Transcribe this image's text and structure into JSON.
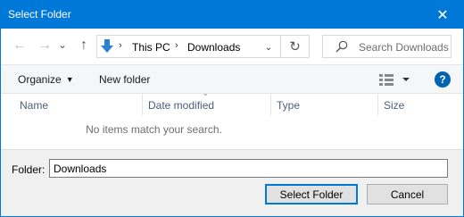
{
  "window": {
    "title": "Select Folder",
    "close_glyph": "✕"
  },
  "nav": {
    "back_glyph": "←",
    "forward_glyph": "→",
    "recent_glyph": "⌄",
    "up_glyph": "↑",
    "breadcrumb": [
      "This PC",
      "Downloads"
    ],
    "breadcrumb_sep": "›",
    "dropdown_glyph": "⌄",
    "refresh_glyph": "↻",
    "search_placeholder": "Search Downloads"
  },
  "commandbar": {
    "organize": "Organize",
    "new_folder": "New folder",
    "help": "?"
  },
  "columns": [
    "Name",
    "Date modified",
    "Type",
    "Size"
  ],
  "list": {
    "empty_message": "No items match your search."
  },
  "footer": {
    "folder_label": "Folder:",
    "folder_value": "Downloads",
    "select_button": "Select Folder",
    "cancel_button": "Cancel"
  },
  "colors": {
    "accent": "#0078d7",
    "help": "#0063b1"
  }
}
